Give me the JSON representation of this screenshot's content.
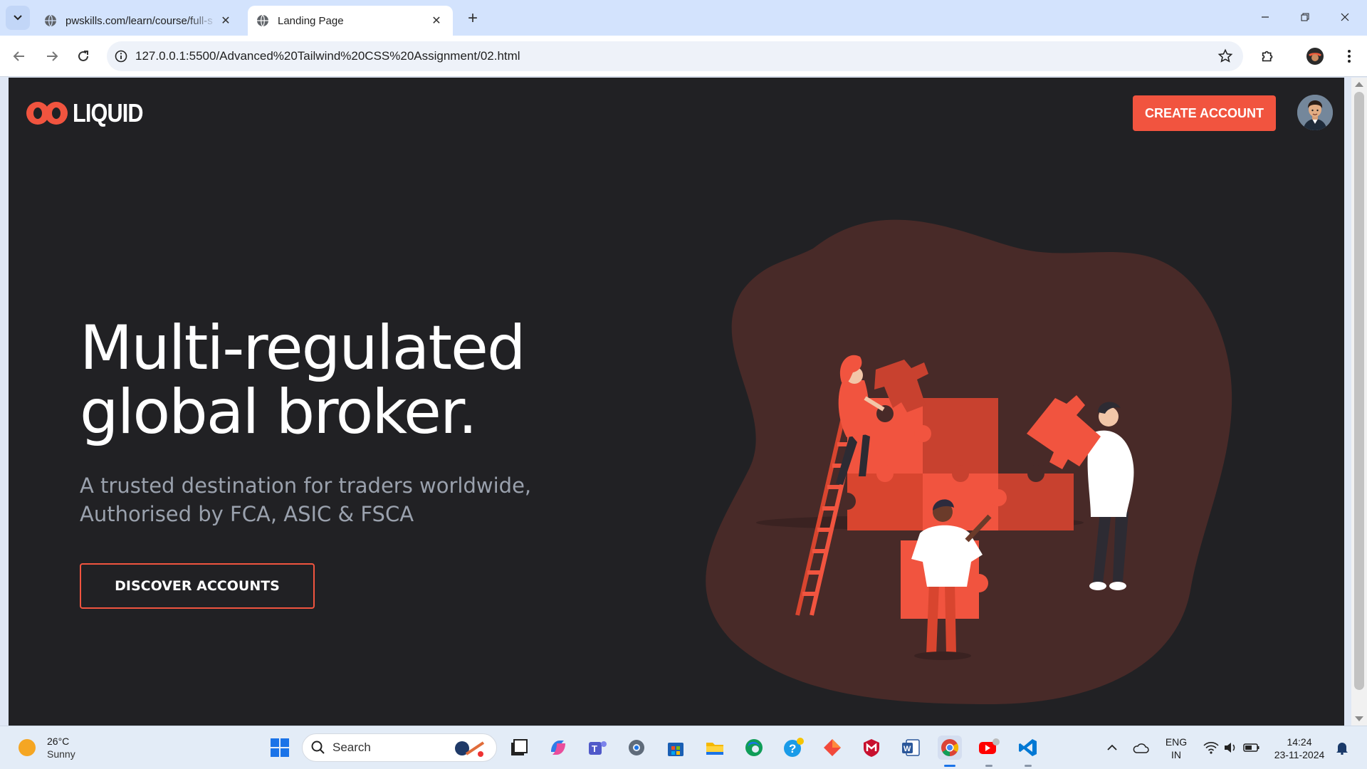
{
  "browser": {
    "tabs": [
      {
        "title": "pwskills.com/learn/course/full-s",
        "active": false
      },
      {
        "title": "Landing Page",
        "active": true
      }
    ],
    "url": "127.0.0.1:5500/Advanced%20Tailwind%20CSS%20Assignment/02.html"
  },
  "page": {
    "brand": "LIQUID",
    "create_account": "CREATE ACCOUNT",
    "hero_line1": "Multi-regulated",
    "hero_line2": "global broker.",
    "subtitle": "A trusted destination for traders worldwide, Authorised by FCA, ASIC & FSCA",
    "discover": "DISCOVER ACCOUNTS",
    "colors": {
      "background": "#212124",
      "accent": "#f1543f",
      "blob": "#482a28"
    }
  },
  "taskbar": {
    "weather_temp": "26°C",
    "weather_cond": "Sunny",
    "search_placeholder": "Search",
    "lang": "ENG",
    "region": "IN",
    "time": "14:24",
    "date": "23-11-2024"
  }
}
